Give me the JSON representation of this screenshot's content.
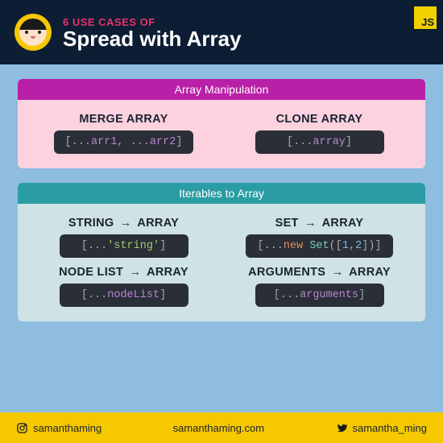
{
  "header": {
    "subtitle": "6 USE CASES OF",
    "title": "Spread with Array",
    "badge": "JS"
  },
  "sections": [
    {
      "heading": "Array Manipulation",
      "variant": "pink",
      "items": [
        {
          "title": "MERGE ARRAY",
          "code_tokens": [
            {
              "t": "[",
              "c": "tok-dot"
            },
            {
              "t": "...",
              "c": "tok-dot"
            },
            {
              "t": "arr1",
              "c": "tok-var"
            },
            {
              "t": ", ",
              "c": "tok-dot"
            },
            {
              "t": "...",
              "c": "tok-dot"
            },
            {
              "t": "arr2",
              "c": "tok-var"
            },
            {
              "t": "]",
              "c": "tok-dot"
            }
          ]
        },
        {
          "title": "CLONE ARRAY",
          "code_tokens": [
            {
              "t": "[",
              "c": "tok-dot"
            },
            {
              "t": "...",
              "c": "tok-dot"
            },
            {
              "t": "array",
              "c": "tok-var"
            },
            {
              "t": "]",
              "c": "tok-dot"
            }
          ]
        }
      ]
    },
    {
      "heading": "Iterables to Array",
      "variant": "teal",
      "items": [
        {
          "title_parts": [
            "STRING",
            "ARRAY"
          ],
          "code_tokens": [
            {
              "t": "[",
              "c": "tok-dot"
            },
            {
              "t": "...",
              "c": "tok-dot"
            },
            {
              "t": "'string'",
              "c": "tok-str"
            },
            {
              "t": "]",
              "c": "tok-dot"
            }
          ]
        },
        {
          "title_parts": [
            "SET",
            "ARRAY"
          ],
          "code_tokens": [
            {
              "t": "[",
              "c": "tok-dot"
            },
            {
              "t": "...",
              "c": "tok-dot"
            },
            {
              "t": "new ",
              "c": "tok-kw"
            },
            {
              "t": "Set",
              "c": "tok-fn"
            },
            {
              "t": "(",
              "c": "tok-dot"
            },
            {
              "t": "[",
              "c": "tok-dot"
            },
            {
              "t": "1",
              "c": "tok-num"
            },
            {
              "t": ",",
              "c": "tok-dot"
            },
            {
              "t": "2",
              "c": "tok-num"
            },
            {
              "t": "]",
              "c": "tok-dot"
            },
            {
              "t": ")",
              "c": "tok-dot"
            },
            {
              "t": "]",
              "c": "tok-dot"
            }
          ]
        },
        {
          "title_parts": [
            "NODE LIST",
            "ARRAY"
          ],
          "code_tokens": [
            {
              "t": "[",
              "c": "tok-dot"
            },
            {
              "t": "...",
              "c": "tok-dot"
            },
            {
              "t": "nodeList",
              "c": "tok-var"
            },
            {
              "t": "]",
              "c": "tok-dot"
            }
          ]
        },
        {
          "title_parts": [
            "ARGUMENTS",
            "ARRAY"
          ],
          "code_tokens": [
            {
              "t": "[",
              "c": "tok-dot"
            },
            {
              "t": "...",
              "c": "tok-dot"
            },
            {
              "t": "arguments",
              "c": "tok-var"
            },
            {
              "t": "]",
              "c": "tok-dot"
            }
          ]
        }
      ]
    }
  ],
  "footer": {
    "instagram": "samanthaming",
    "site": "samanthaming.com",
    "twitter": "samantha_ming"
  }
}
